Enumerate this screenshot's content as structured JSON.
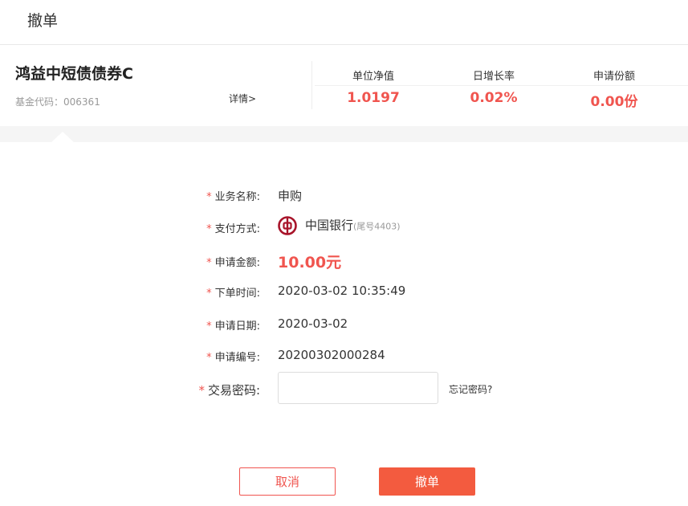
{
  "header": {
    "title": "撤单"
  },
  "fund": {
    "name": "鸿益中短债债券C",
    "code_label": "基金代码：",
    "code": "006361",
    "detail_link": "详情>"
  },
  "stats": [
    {
      "label": "单位净值",
      "value": "1.0197"
    },
    {
      "label": "日增长率",
      "value": "0.02%"
    },
    {
      "label": "申请份额",
      "value": "0.00份"
    }
  ],
  "form": {
    "required_mark": "*",
    "business": {
      "label": "业务名称:",
      "value": "申购"
    },
    "payment": {
      "label": "支付方式:",
      "bank": "中国银行",
      "suffix": "(尾号4403)",
      "icon": "bank-of-china-icon"
    },
    "amount": {
      "label": "申请金额:",
      "value": "10.00元"
    },
    "order_time": {
      "label": "下单时间:",
      "value": "2020-03-02 10:35:49"
    },
    "apply_date": {
      "label": "申请日期:",
      "value": "2020-03-02"
    },
    "apply_no": {
      "label": "申请编号:",
      "value": "20200302000284"
    },
    "password": {
      "label": "交易密码:",
      "value": "",
      "placeholder": ""
    },
    "forgot_link": "忘记密码?"
  },
  "buttons": {
    "cancel": "取消",
    "submit": "撤单"
  },
  "colors": {
    "accent": "#f0554f",
    "button": "#f35b3f",
    "bank": "#a8142a"
  }
}
